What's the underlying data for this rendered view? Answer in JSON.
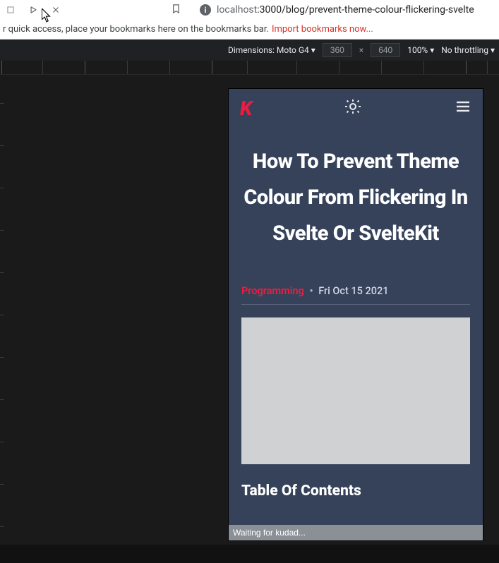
{
  "browser": {
    "url_host": "localhost",
    "url_path": ":3000/blog/prevent-theme-colour-flickering-svelte",
    "bookmark_hint": "r quick access, place your bookmarks here on the bookmarks bar.",
    "import_link": "Import bookmarks now..."
  },
  "devtools": {
    "dimensions_label": "Dimensions:",
    "device": "Moto G4",
    "width": "360",
    "height": "640",
    "zoom": "100%",
    "throttling": "No throttling"
  },
  "site": {
    "logo": "K",
    "title": "How To Prevent Theme Colour From Flickering In Svelte Or SvelteKit",
    "category": "Programming",
    "separator": "•",
    "date": "Fri Oct 15 2021",
    "toc_heading": "Table Of Contents"
  },
  "status": {
    "text": "Waiting for kudad..."
  }
}
